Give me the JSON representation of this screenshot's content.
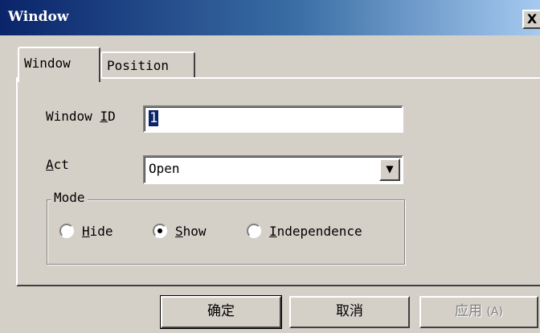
{
  "window": {
    "title": "Window",
    "close_label": "X"
  },
  "tabs": [
    {
      "label": "Window",
      "active": true
    },
    {
      "label": "Position",
      "active": false
    }
  ],
  "form": {
    "window_id": {
      "label": "Window ID",
      "value": "1"
    },
    "act": {
      "label": "Act",
      "value": "Open"
    },
    "mode": {
      "legend": "Mode",
      "options": [
        {
          "label": "Hide",
          "selected": false
        },
        {
          "label": "Show",
          "selected": true
        },
        {
          "label": "Independence",
          "selected": false
        }
      ]
    }
  },
  "buttons": {
    "ok": "确定",
    "cancel": "取消",
    "apply": "应用",
    "apply_shortcut": "(A)"
  },
  "icons": {
    "dropdown": "chevron-down-icon",
    "close": "close-icon"
  },
  "colors": {
    "titlebar_start": "#0a246a",
    "titlebar_end": "#a6caf0",
    "face": "#d4d0c8",
    "selection": "#0a246a"
  }
}
